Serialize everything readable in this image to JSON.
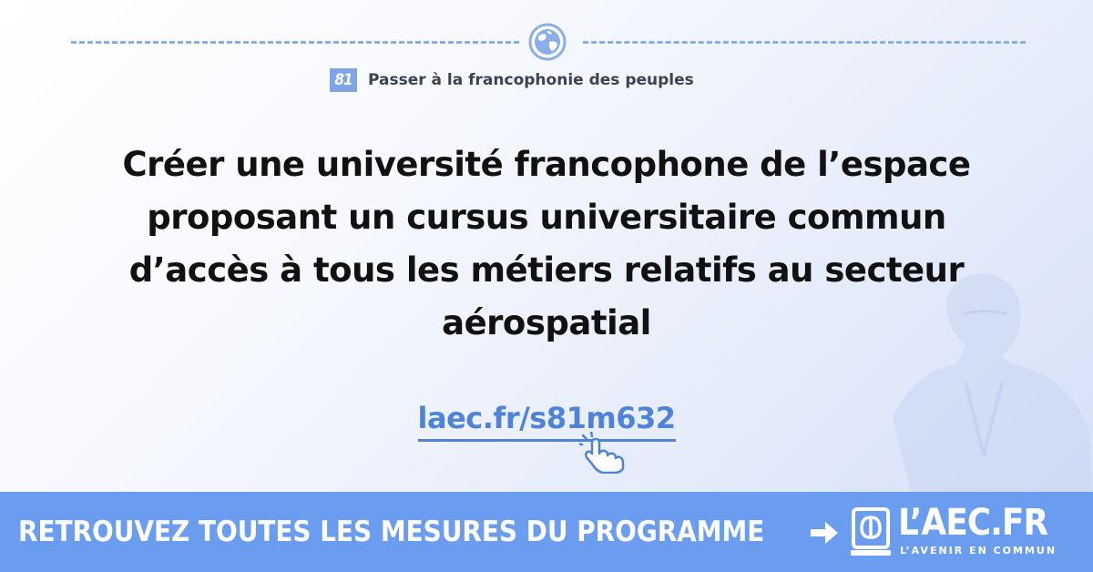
{
  "header": {
    "icon": "globe-icon",
    "chapter_number": "81",
    "chapter_title": "Passer à la francophonie des peuples"
  },
  "main": {
    "headline_lines": [
      "Créer une université francophone de l’espace",
      "proposant un cursus universitaire commun",
      "d’accès à tous les métiers relatifs au secteur",
      "aérospatial"
    ],
    "link_text": "laec.fr/s81m632",
    "link_icon": "pointer-hand-icon"
  },
  "footer": {
    "cta_label": "RETROUVEZ TOUTES LES MESURES DU PROGRAMME",
    "arrow_icon": "arrow-right-icon",
    "logo_icon": "laec-logo-icon",
    "logo_text": "L’AEC.FR",
    "logo_tagline": "L’AVENIR EN COMMUN"
  },
  "colors": {
    "accent": "#6a9df0",
    "link": "#4f82d9",
    "badge": "#7ea6e6",
    "text": "#111111"
  }
}
